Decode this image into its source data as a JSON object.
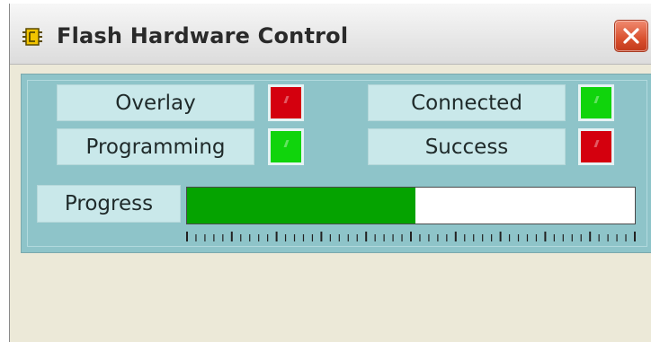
{
  "window": {
    "title": "Flash Hardware Control",
    "icon": "chip-icon",
    "close_icon": "close-x-icon"
  },
  "status": {
    "overlay": {
      "label": "Overlay",
      "state": "off",
      "color": "#d4000e"
    },
    "programming": {
      "label": "Programming",
      "state": "on",
      "color": "#10d40c"
    },
    "connected": {
      "label": "Connected",
      "state": "on",
      "color": "#10d40c"
    },
    "success": {
      "label": "Success",
      "state": "off",
      "color": "#d4000e"
    }
  },
  "progress": {
    "label": "Progress",
    "value": 0.51,
    "fill_color": "#05a300"
  },
  "colors": {
    "panel": "#8ec4c9",
    "label_box": "#c9e8ea",
    "window_body": "#ece9d8"
  }
}
